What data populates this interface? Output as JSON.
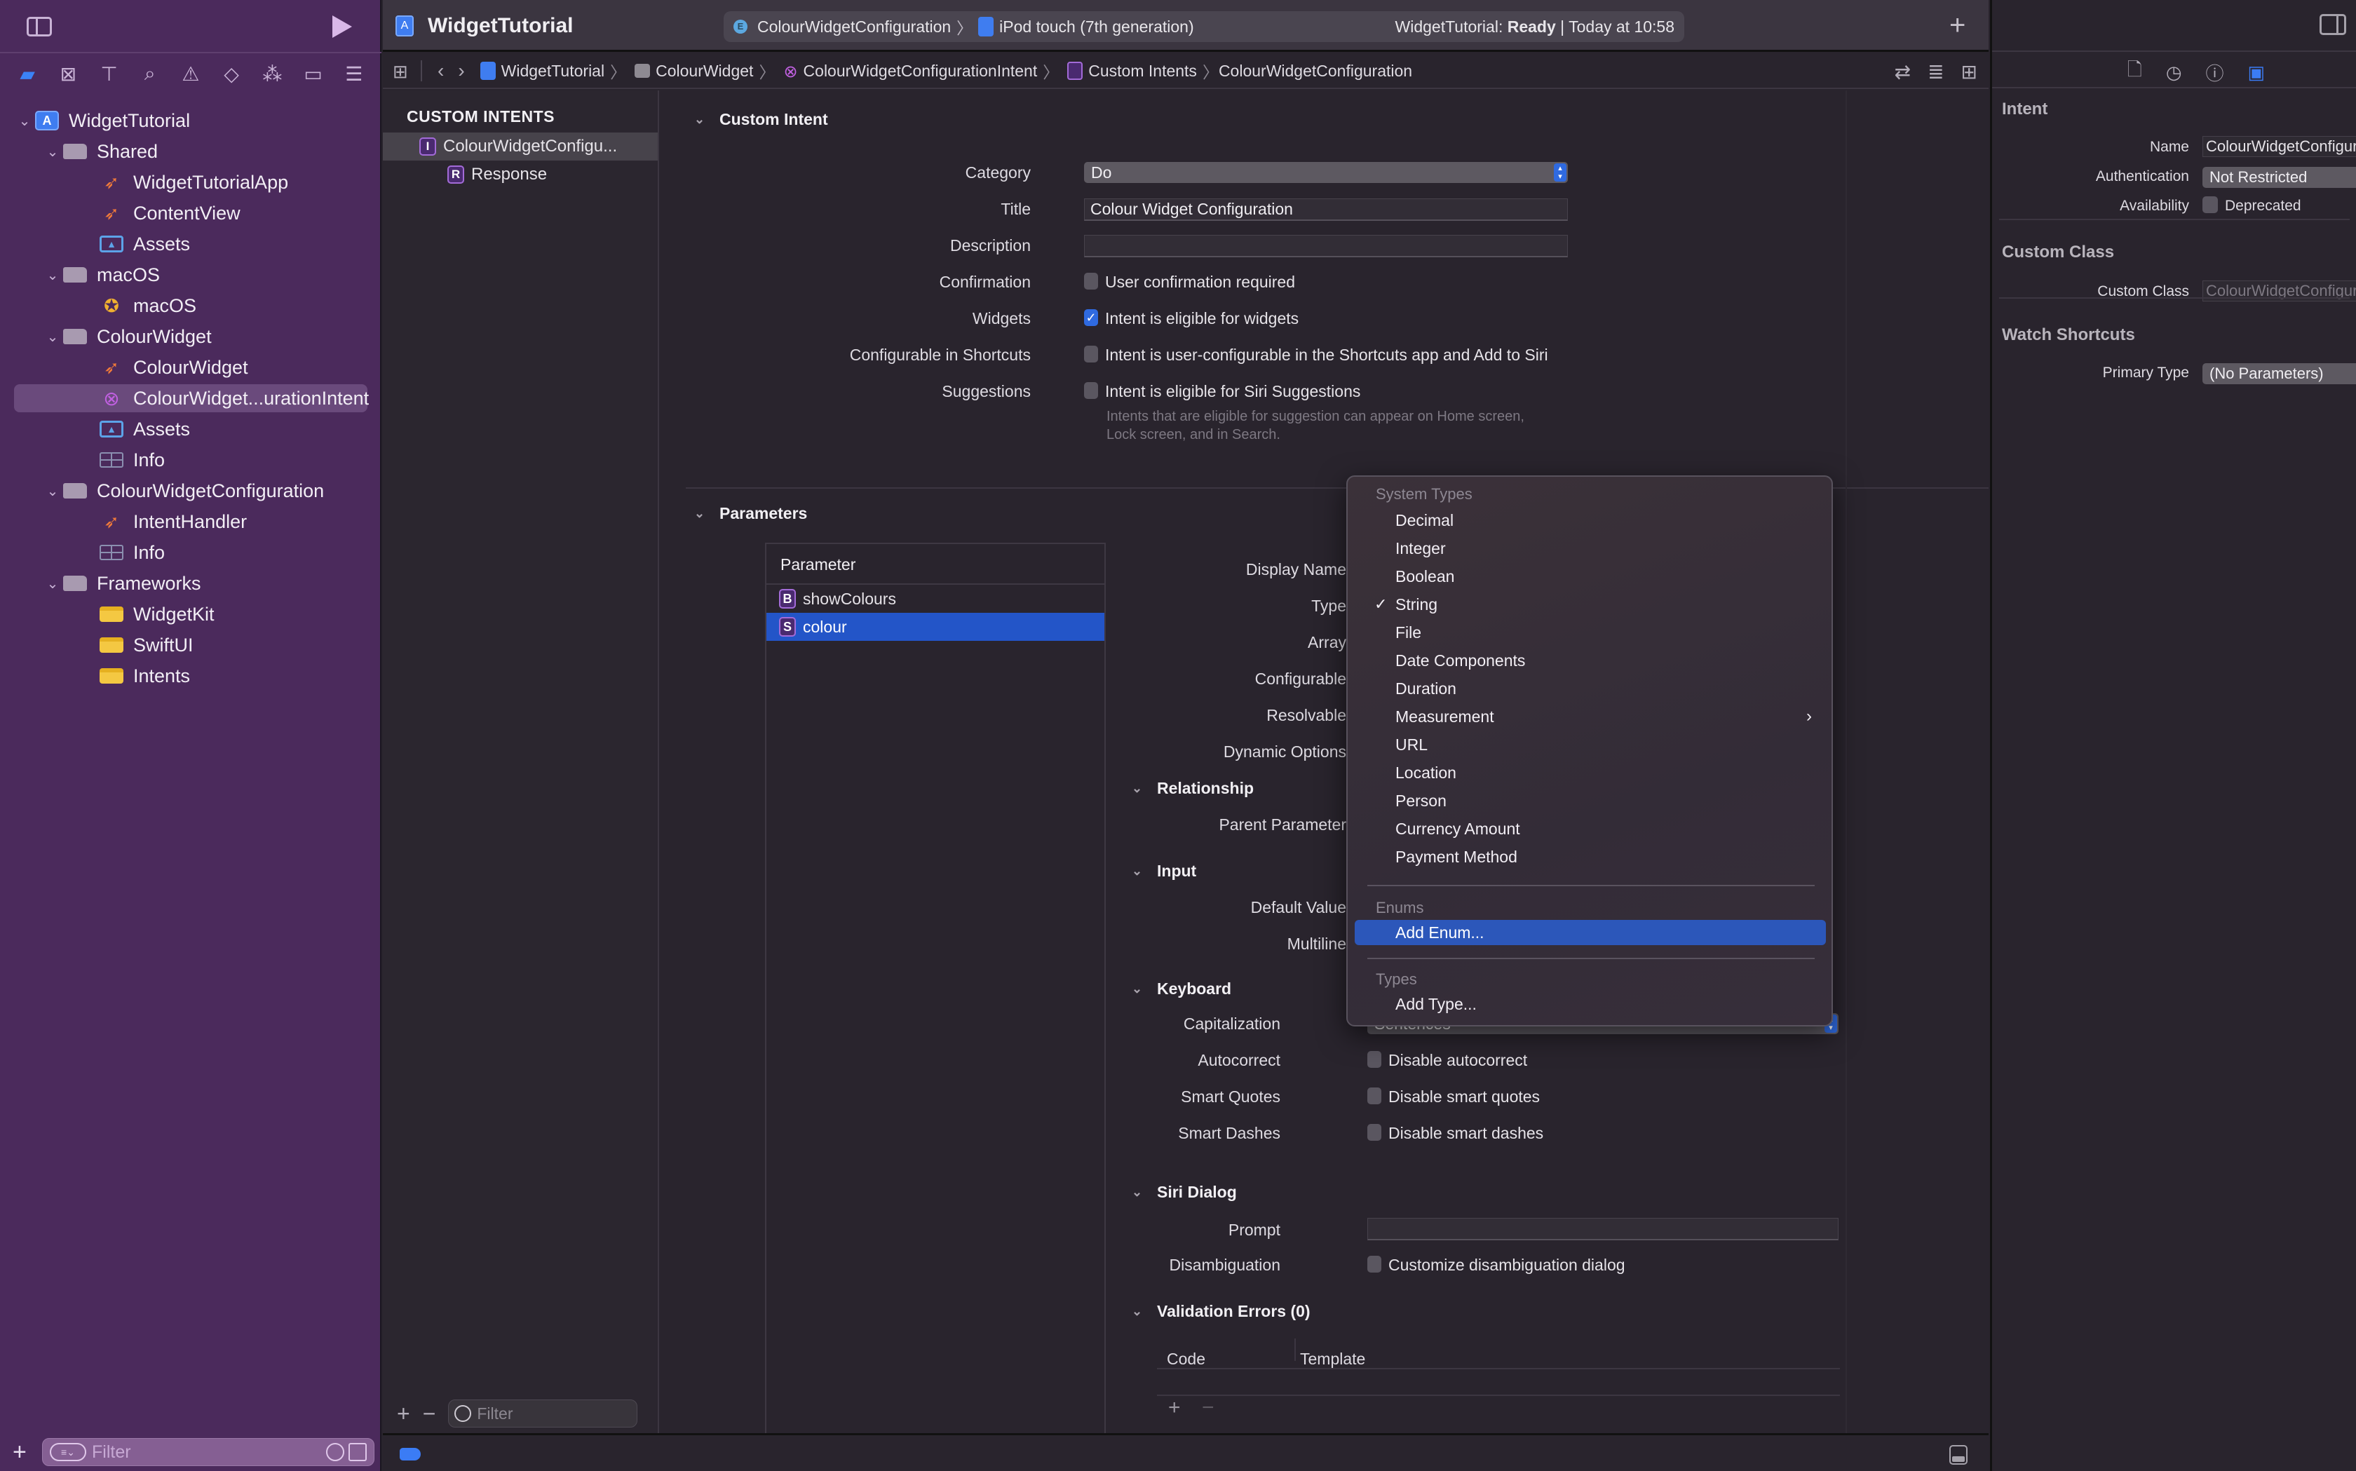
{
  "navigator": {
    "tabs": [
      {
        "name": "project-navigator",
        "icon": "folder-icon",
        "active": true
      },
      {
        "name": "source-control-navigator",
        "icon": "source-control-icon"
      },
      {
        "name": "symbol-navigator",
        "icon": "hierarchy-icon"
      },
      {
        "name": "find-navigator",
        "icon": "search-icon"
      },
      {
        "name": "issue-navigator",
        "icon": "warning-icon"
      },
      {
        "name": "test-navigator",
        "icon": "test-diamond-icon"
      },
      {
        "name": "debug-navigator",
        "icon": "spray-icon"
      },
      {
        "name": "breakpoint-navigator",
        "icon": "breakpoint-icon"
      },
      {
        "name": "report-navigator",
        "icon": "report-icon"
      }
    ],
    "tree": [
      {
        "label": "WidgetTutorial",
        "icon": "project",
        "level": 0,
        "expanded": true
      },
      {
        "label": "Shared",
        "icon": "folder",
        "level": 1,
        "expanded": true
      },
      {
        "label": "WidgetTutorialApp",
        "icon": "swift",
        "level": 2
      },
      {
        "label": "ContentView",
        "icon": "swift",
        "level": 2
      },
      {
        "label": "Assets",
        "icon": "assets",
        "level": 2
      },
      {
        "label": "macOS",
        "icon": "folder",
        "level": 1,
        "expanded": true
      },
      {
        "label": "macOS",
        "icon": "entitlements",
        "level": 2
      },
      {
        "label": "ColourWidget",
        "icon": "folder",
        "level": 1,
        "expanded": true
      },
      {
        "label": "ColourWidget",
        "icon": "swift",
        "level": 2
      },
      {
        "label": "ColourWidget...urationIntent",
        "icon": "intent",
        "level": 2,
        "selected": true
      },
      {
        "label": "Assets",
        "icon": "assets",
        "level": 2
      },
      {
        "label": "Info",
        "icon": "plist",
        "level": 2
      },
      {
        "label": "ColourWidgetConfiguration",
        "icon": "folder",
        "level": 1,
        "expanded": true
      },
      {
        "label": "IntentHandler",
        "icon": "swift",
        "level": 2
      },
      {
        "label": "Info",
        "icon": "plist",
        "level": 2
      },
      {
        "label": "Frameworks",
        "icon": "folder",
        "level": 1,
        "expanded": true
      },
      {
        "label": "WidgetKit",
        "icon": "framework",
        "level": 2
      },
      {
        "label": "SwiftUI",
        "icon": "framework",
        "level": 2
      },
      {
        "label": "Intents",
        "icon": "framework",
        "level": 2
      }
    ],
    "filter_placeholder": "Filter"
  },
  "toolbar": {
    "project_title": "WidgetTutorial",
    "scheme": "ColourWidgetConfiguration",
    "destination": "iPod touch (7th generation)",
    "status_prefix": "WidgetTutorial: ",
    "status_state": "Ready",
    "status_suffix": " | Today at 10:58"
  },
  "jumpbar": {
    "crumbs": [
      "WidgetTutorial",
      "ColourWidget",
      "ColourWidgetConfigurationIntent",
      "Custom Intents",
      "ColourWidgetConfiguration"
    ]
  },
  "intent_list": {
    "header": "CUSTOM INTENTS",
    "items": [
      {
        "badge": "I",
        "label": "ColourWidgetConfigu...",
        "selected": true
      },
      {
        "badge": "R",
        "label": "Response"
      }
    ],
    "filter_placeholder": "Filter"
  },
  "custom_intent": {
    "section_title": "Custom Intent",
    "category_label": "Category",
    "category_value": "Do",
    "title_label": "Title",
    "title_value": "Colour Widget Configuration",
    "description_label": "Description",
    "description_value": "",
    "confirmation_label": "Confirmation",
    "confirmation_text": "User confirmation required",
    "confirmation_checked": false,
    "widgets_label": "Widgets",
    "widgets_text": "Intent is eligible for widgets",
    "widgets_checked": true,
    "shortcuts_label": "Configurable in Shortcuts",
    "shortcuts_text": "Intent is user-configurable in the Shortcuts app and Add to Siri",
    "shortcuts_checked": false,
    "suggestions_label": "Suggestions",
    "suggestions_text": "Intent is eligible for Siri Suggestions",
    "suggestions_checked": false,
    "suggestions_hint_1": "Intents that are eligible for suggestion can appear on Home screen,",
    "suggestions_hint_2": "Lock screen, and in Search."
  },
  "parameters": {
    "section_title": "Parameters",
    "table_header": "Parameter",
    "rows": [
      {
        "badge": "B",
        "name": "showColours"
      },
      {
        "badge": "S",
        "name": "colour",
        "selected": true
      }
    ],
    "detail_labels": {
      "display_name": "Display Name",
      "type": "Type",
      "array": "Array",
      "configurable": "Configurable",
      "resolvable": "Resolvable",
      "dynamic_options": "Dynamic Options",
      "parent_parameter": "Parent Parameter",
      "default_value": "Default Value",
      "multiline": "Multiline",
      "capitalization": "Capitalization",
      "autocorrect": "Autocorrect",
      "smart_quotes": "Smart Quotes",
      "smart_dashes": "Smart Dashes",
      "prompt": "Prompt",
      "disambiguation": "Disambiguation"
    },
    "sections": {
      "relationship": "Relationship",
      "input": "Input",
      "keyboard": "Keyboard",
      "siri_dialog": "Siri Dialog",
      "validation_errors": "Validation Errors (0)"
    },
    "capitalization_value": "Sentences",
    "autocorrect_text": "Disable autocorrect",
    "smart_quotes_text": "Disable smart quotes",
    "smart_dashes_text": "Disable smart dashes",
    "disambiguation_text": "Customize disambiguation dialog",
    "validation_columns": [
      "Code",
      "Template"
    ]
  },
  "type_menu": {
    "system_header": "System Types",
    "system_items": [
      {
        "label": "Decimal"
      },
      {
        "label": "Integer"
      },
      {
        "label": "Boolean"
      },
      {
        "label": "String",
        "checked": true
      },
      {
        "label": "File"
      },
      {
        "label": "Date Components"
      },
      {
        "label": "Duration"
      },
      {
        "label": "Measurement",
        "submenu": true
      },
      {
        "label": "URL"
      },
      {
        "label": "Location"
      },
      {
        "label": "Person"
      },
      {
        "label": "Currency Amount"
      },
      {
        "label": "Payment Method"
      }
    ],
    "enums_header": "Enums",
    "add_enum": "Add Enum...",
    "types_header": "Types",
    "add_type": "Add Type..."
  },
  "inspector": {
    "tabs": [
      "file-inspector",
      "history-inspector",
      "quick-help-inspector",
      "attributes-inspector"
    ],
    "intent_header": "Intent",
    "name_label": "Name",
    "name_value": "ColourWidgetConfiguration",
    "auth_label": "Authentication",
    "auth_value": "Not Restricted",
    "availability_label": "Availability",
    "availability_text": "Deprecated",
    "custom_class_header": "Custom Class",
    "custom_class_label": "Custom Class",
    "custom_class_placeholder": "ColourWidgetConfigurationInte",
    "watch_header": "Watch Shortcuts",
    "primary_type_label": "Primary Type",
    "primary_type_value": "(No Parameters)"
  },
  "colors": {
    "navigator_bg": "#4b2a5c",
    "accent_blue": "#2f6ae0",
    "selection_blue": "#2355c8",
    "menu_highlight": "#2c57ba"
  }
}
